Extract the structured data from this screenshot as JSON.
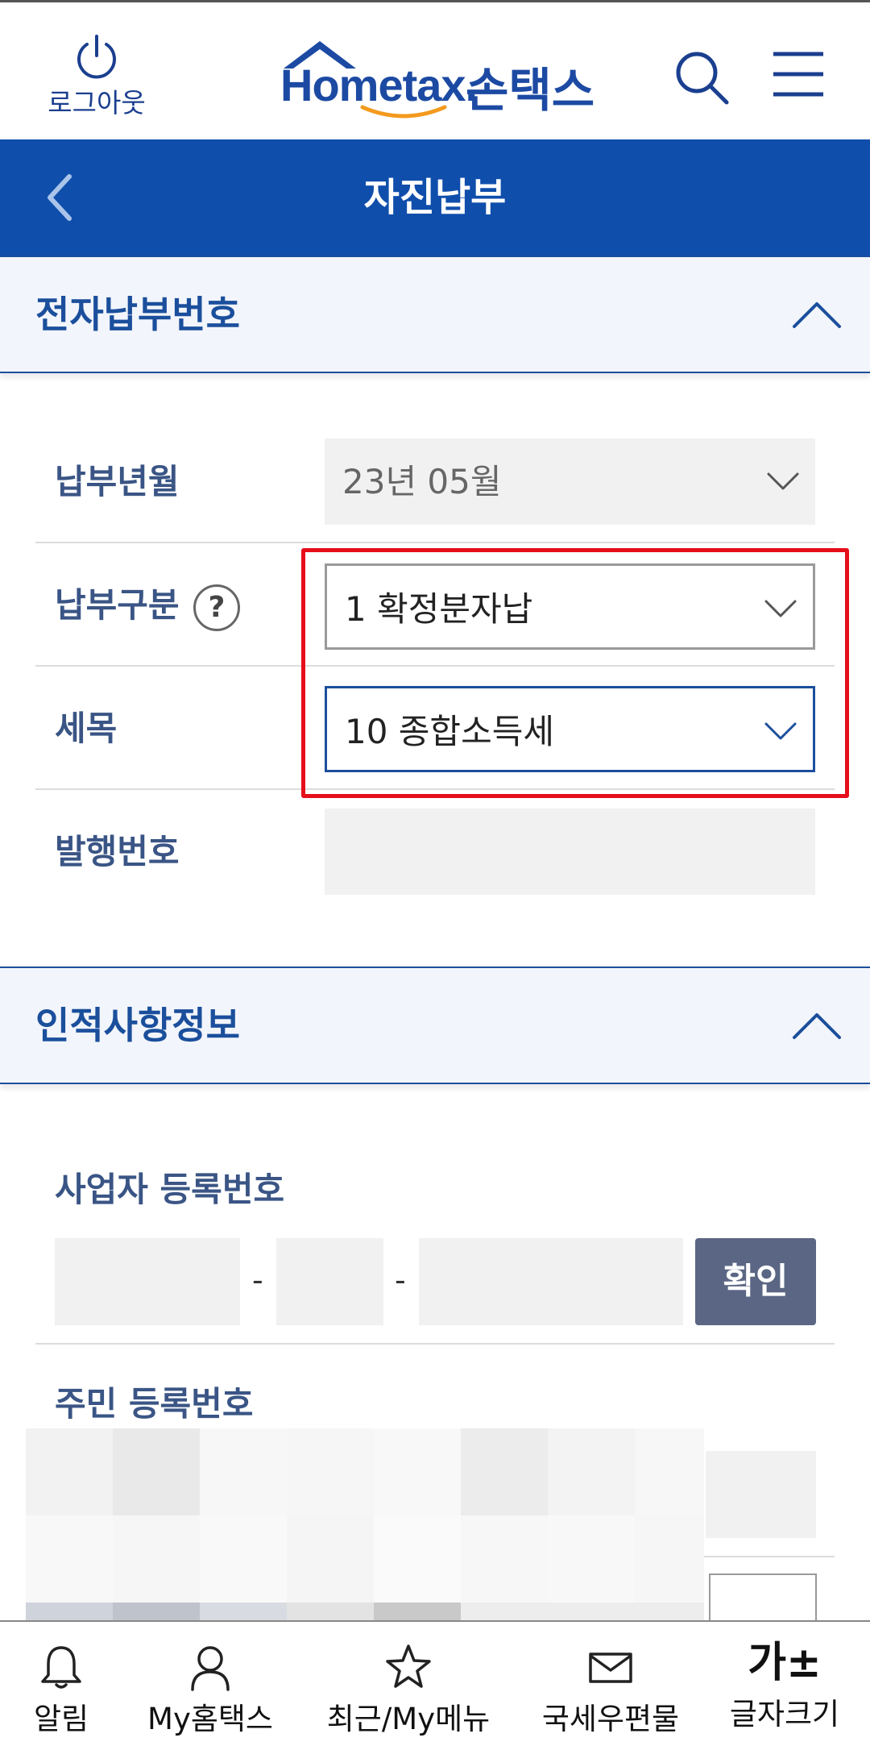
{
  "header": {
    "logout_label": "로그아웃",
    "logo_text": "Hometax.",
    "logo_kor": "손택스"
  },
  "titlebar": {
    "title": "자진납부"
  },
  "section_payment": {
    "title": "전자납부번호",
    "rows": {
      "month": {
        "label": "납부년월",
        "value": "23년 05월"
      },
      "type": {
        "label": "납부구분",
        "help": "?",
        "value": "1 확정분자납"
      },
      "tax": {
        "label": "세목",
        "value": "10 종합소득세"
      },
      "issue": {
        "label": "발행번호",
        "value": ""
      }
    }
  },
  "section_personal": {
    "title": "인적사항정보",
    "biz_reg_label": "사업자 등록번호",
    "dash": "-",
    "confirm_label": "확인",
    "resident_label": "주민 등록번호"
  },
  "bottom_nav": {
    "alert": "알림",
    "my_hometax": "My홈택스",
    "recent_menu": "최근/My메뉴",
    "mail": "국세우편물",
    "font_size_glyph": "가±",
    "font_size": "글자크기"
  },
  "colors": {
    "primary_blue": "#0f4eab",
    "highlight_red": "#e60e1b",
    "confirm_button": "#5a6683"
  }
}
